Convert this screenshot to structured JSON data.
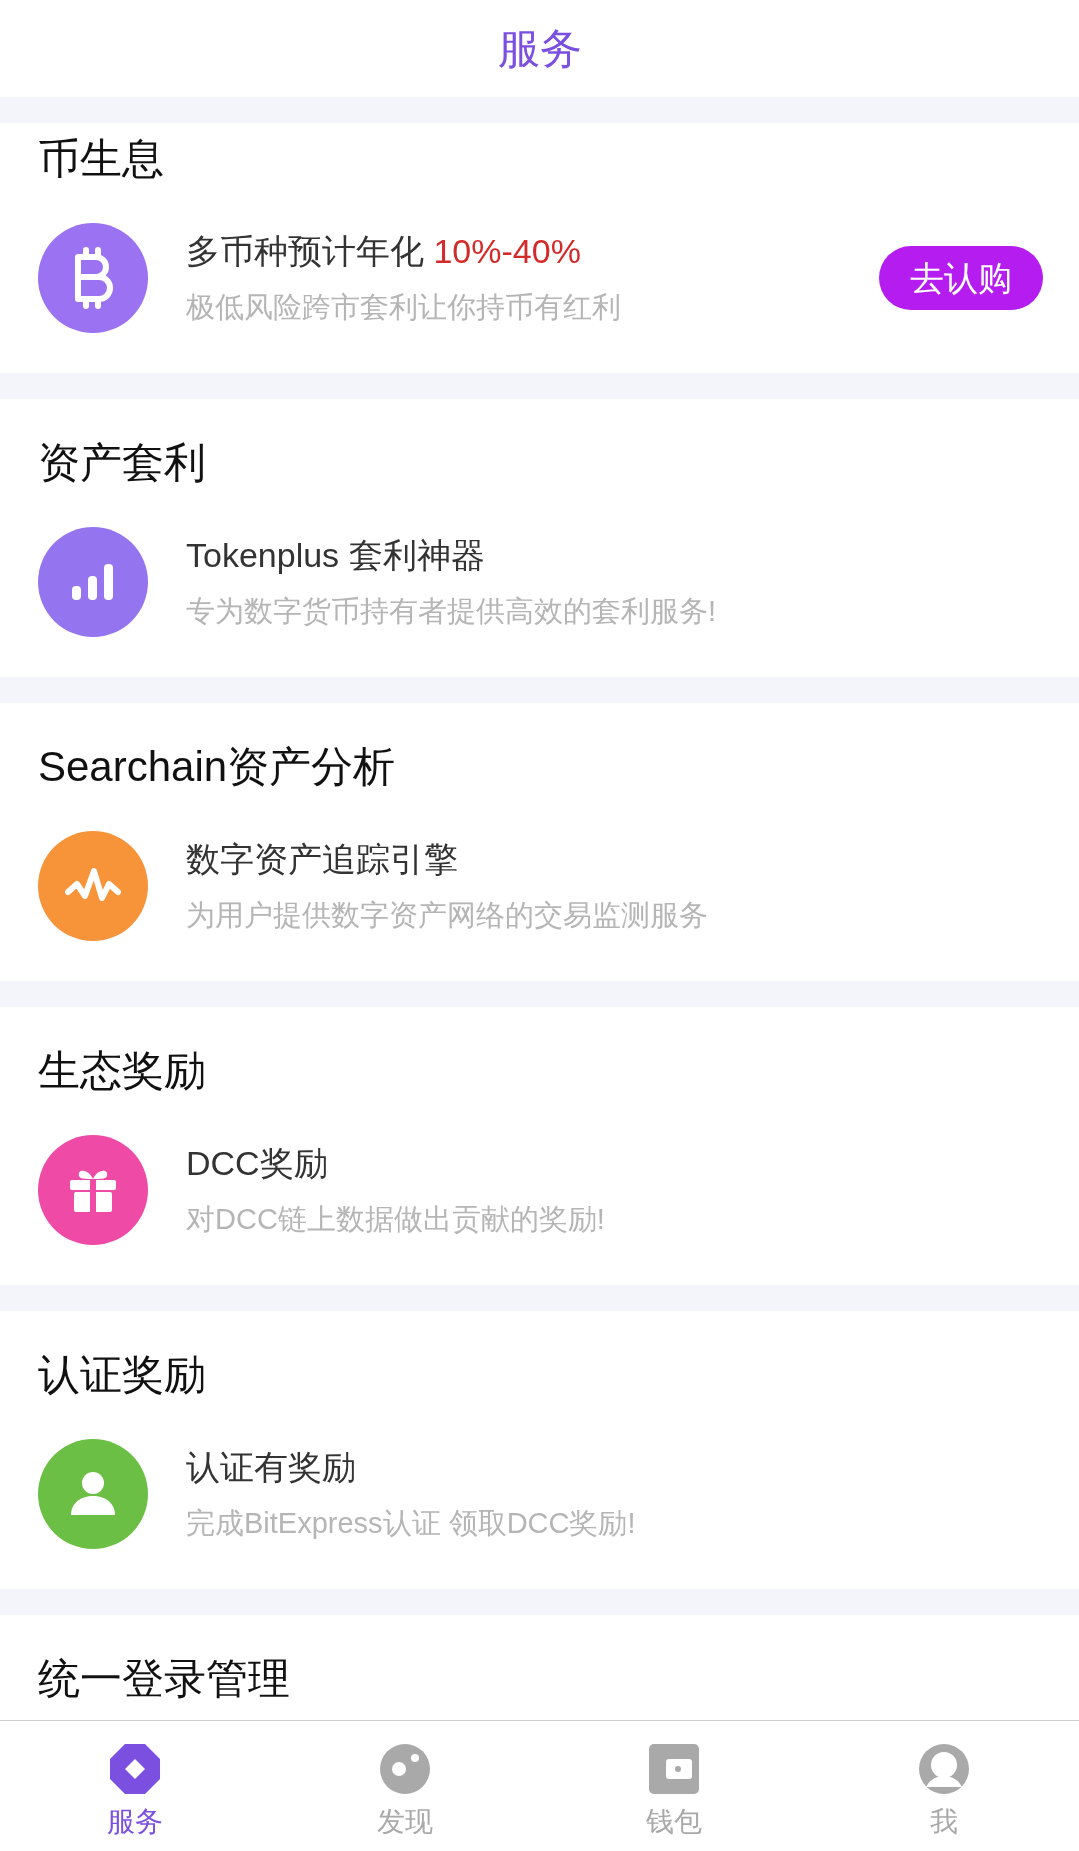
{
  "header": {
    "title": "服务"
  },
  "sections": [
    {
      "title": "币生息",
      "items": [
        {
          "color": "#9b72f2",
          "title": "多币种预计年化 ",
          "highlight": "10%-40%",
          "subtitle": "极低风险跨市套利让你持币有红利",
          "button": "去认购"
        }
      ]
    },
    {
      "title": "资产套利",
      "items": [
        {
          "color": "#9574f0",
          "title": "Tokenplus 套利神器",
          "subtitle": "专为数字货币持有者提供高效的套利服务!"
        }
      ]
    },
    {
      "title": "Searchain资产分析",
      "items": [
        {
          "color": "#f7943a",
          "title": "数字资产追踪引擎",
          "subtitle": "为用户提供数字资产网络的交易监测服务"
        }
      ]
    },
    {
      "title": "生态奖励",
      "items": [
        {
          "color": "#ee4aa6",
          "title": "DCC奖励",
          "subtitle": "对DCC链上数据做出贡献的奖励!"
        }
      ]
    },
    {
      "title": "认证奖励",
      "items": [
        {
          "color": "#6cbf45",
          "title": "认证有奖励",
          "subtitle": "完成BitExpress认证 领取DCC奖励!"
        }
      ]
    },
    {
      "title": "统一登录管理"
    }
  ],
  "tabs": [
    {
      "label": "服务",
      "selected": true
    },
    {
      "label": "发现",
      "selected": false
    },
    {
      "label": "钱包",
      "selected": false
    },
    {
      "label": "我",
      "selected": false
    }
  ]
}
